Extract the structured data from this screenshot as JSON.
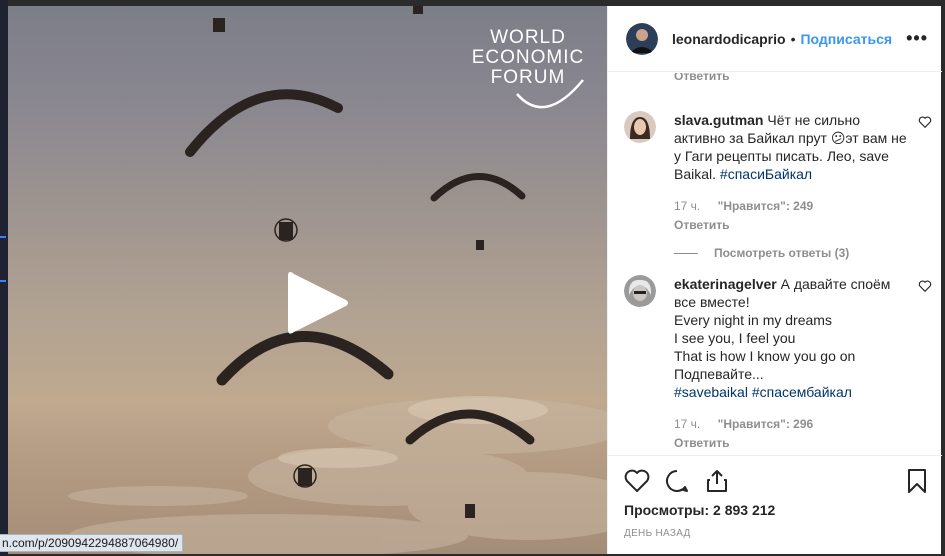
{
  "video": {
    "watermark": [
      "WORLD",
      "ECONOMIC",
      "FORUM"
    ]
  },
  "header": {
    "username": "leonardodicaprio",
    "separator": "•",
    "follow_label": "Подписаться",
    "more_label": "•••"
  },
  "comments": {
    "top_reply_label": "Ответить",
    "items": [
      {
        "username": "slava.gutman",
        "text": "Чёт не сильно активно за Байкал прут 😕эт вам не у Гаги рецепты писать. Лео, save Baikal.",
        "hashtags": "#спасиБайкал",
        "time": "17 ч.",
        "likes": "\"Нравится\": 249",
        "reply_label": "Ответить",
        "view_replies": "Посмотреть ответы (3)"
      },
      {
        "username": "ekaterinagelver",
        "text_lines": [
          "А давайте споём все вместе!",
          "Every night in my dreams",
          "I see you, I feel you",
          "That is how I know you go on",
          "Подпевайте..."
        ],
        "hashtags": "#savebaikal #спасембайкал",
        "time": "17 ч.",
        "likes": "\"Нравится\": 296",
        "reply_label": "Ответить"
      }
    ]
  },
  "actions": {
    "icons": [
      "heart-icon",
      "comment-icon",
      "share-icon",
      "bookmark-icon"
    ],
    "views": "Просмотры: 2 893 212",
    "posted": "ДЕНЬ НАЗАД"
  },
  "status_url": "n.com/p/2090942294887064980/",
  "colors": {
    "link": "#3897f0",
    "hashtag": "#003569",
    "muted": "#8e8e8e",
    "text": "#262626"
  }
}
